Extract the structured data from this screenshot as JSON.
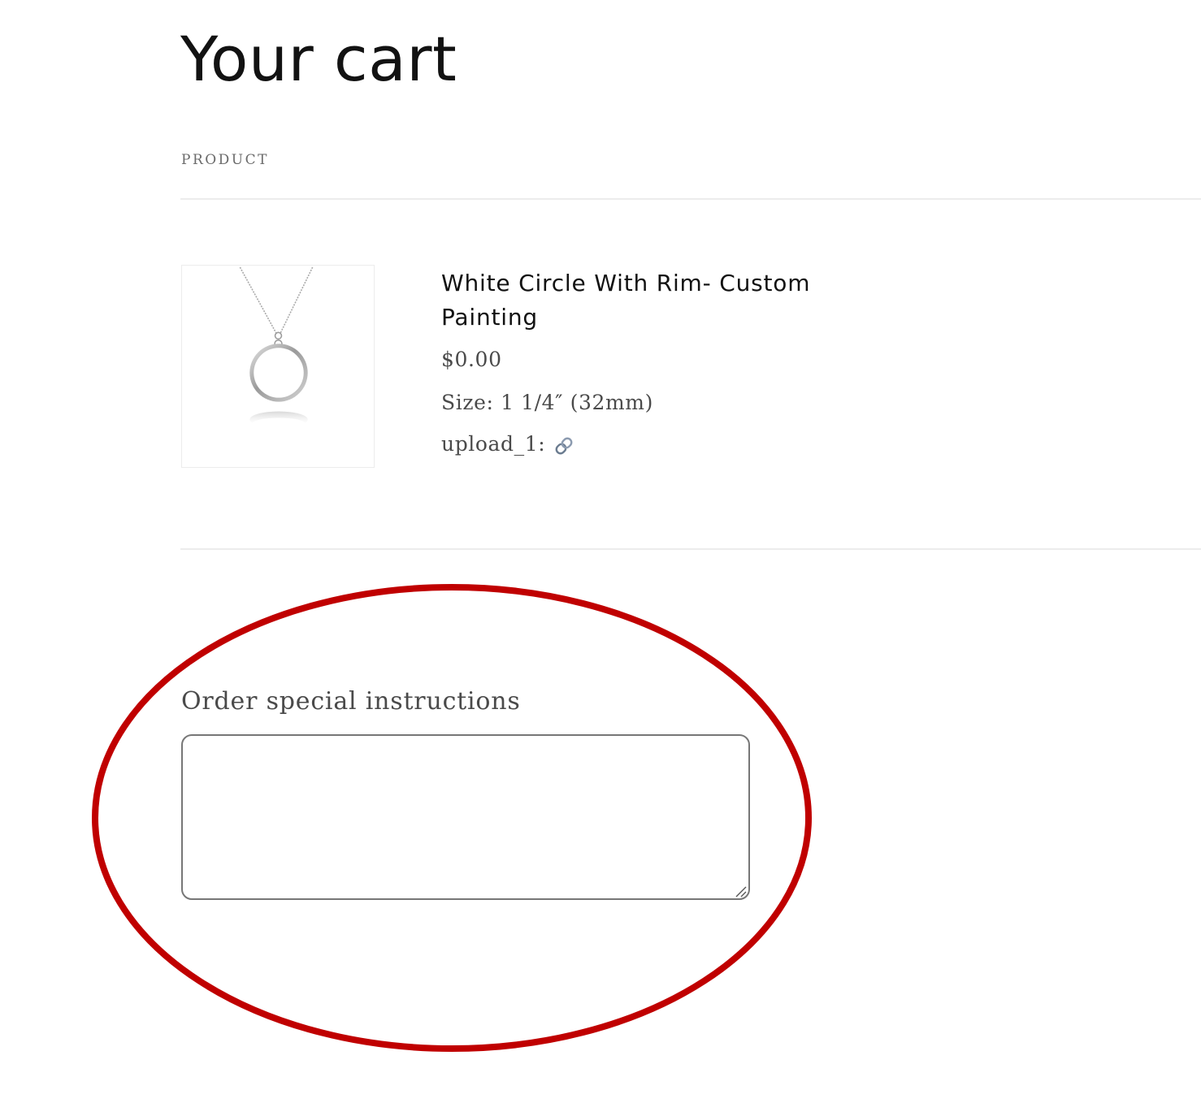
{
  "page": {
    "title": "Your cart"
  },
  "table": {
    "product_header": "PRODUCT"
  },
  "cart_item": {
    "name": "White Circle With Rim- Custom Painting",
    "price": "$0.00",
    "properties": [
      {
        "label": "Size:",
        "value": "1 1/4″ (32mm)"
      },
      {
        "label": "upload_1:",
        "value_icon": "link-icon"
      }
    ],
    "image_icon": "circle-pendant-necklace"
  },
  "order_notes": {
    "label": "Order special instructions",
    "value": ""
  },
  "colors": {
    "annotation_ring": "#c00000",
    "heading_text": "#121212",
    "body_text": "#4a4a4a",
    "divider": "#ececec",
    "link": "#2a2a9e"
  }
}
